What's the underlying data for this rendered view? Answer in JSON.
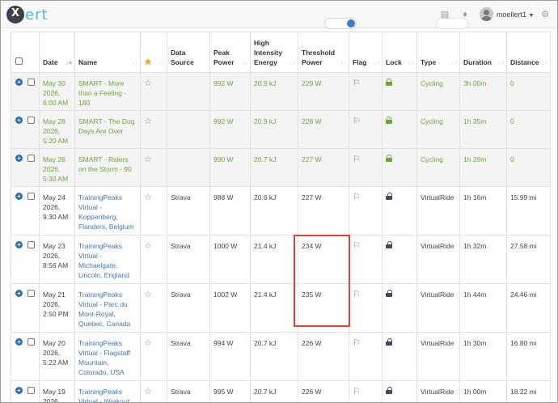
{
  "app": {
    "logo_text": "ert",
    "logo_mark": "X",
    "username": "moellert1"
  },
  "columns": {
    "date": "Date",
    "name": "Name",
    "data_source": "Data Source",
    "peak_power": "Peak Power",
    "hie": "High Intensity Energy",
    "threshold_power": "Threshold Power",
    "flag": "Flag",
    "lock": "Lock",
    "type": "Type",
    "duration": "Duration",
    "distance": "Distance"
  },
  "rows": [
    {
      "planned": true,
      "date": "May 30 2026, 6:00 AM",
      "name": "SMART - More than a Feeling - 180",
      "source": "",
      "peak": "992 W",
      "hie": "20.9 kJ",
      "threshold": "229 W",
      "type": "Cycling",
      "duration": "3h 00m",
      "distance": "0"
    },
    {
      "planned": true,
      "date": "May 28 2026, 5:20 AM",
      "name": "SMART - The Dog Days Are Over",
      "source": "",
      "peak": "992 W",
      "hie": "20.9 kJ",
      "threshold": "228 W",
      "type": "Cycling",
      "duration": "1h 35m",
      "distance": "0"
    },
    {
      "planned": true,
      "date": "May 26 2026, 5:30 AM",
      "name": "SMART - Riders on the Storm - 90",
      "source": "",
      "peak": "990 W",
      "hie": "20.7 kJ",
      "threshold": "227 W",
      "type": "Cycling",
      "duration": "1h 29m",
      "distance": "0"
    },
    {
      "planned": false,
      "date": "May 24 2026, 9:30 AM",
      "name": "TrainingPeaks Virtual - Koppenberg, Flanders, Belgium",
      "source": "Strava",
      "peak": "988 W",
      "hie": "20.6 kJ",
      "threshold": "227 W",
      "type": "VirtualRide",
      "duration": "1h 16m",
      "distance": "15.99 mi"
    },
    {
      "planned": false,
      "date": "May 23 2026, 8:56 AM",
      "name": "TrainingPeaks Virtual - Michaelgate, Lincoln, England",
      "source": "Strava",
      "peak": "1000 W",
      "hie": "21.4 kJ",
      "threshold": "234 W",
      "type": "VirtualRide",
      "duration": "1h 32m",
      "distance": "27.58 mi"
    },
    {
      "planned": false,
      "date": "May 21 2026, 2:50 PM",
      "name": "TrainingPeaks Virtual - Parc du Mont-Royal, Quebec, Canada",
      "source": "Strava",
      "peak": "1002 W",
      "hie": "21.4 kJ",
      "threshold": "235 W",
      "type": "VirtualRide",
      "duration": "1h 44m",
      "distance": "24.46 mi"
    },
    {
      "planned": false,
      "date": "May 20 2026, 5:22 AM",
      "name": "TrainingPeaks Virtual - Flagstaff Mountain, Colorado, USA",
      "source": "Strava",
      "peak": "994 W",
      "hie": "20.7 kJ",
      "threshold": "226 W",
      "type": "VirtualRide",
      "duration": "1h 30m",
      "distance": "16.80 mi"
    },
    {
      "planned": false,
      "date": "May 19 2026,",
      "name": "TrainingPeaks Virtual - Workout:",
      "source": "Strava",
      "peak": "995 W",
      "hie": "20.7 kJ",
      "threshold": "226 W",
      "type": "VirtualRide",
      "duration": "1h 00m",
      "distance": "18.22 mi"
    }
  ]
}
